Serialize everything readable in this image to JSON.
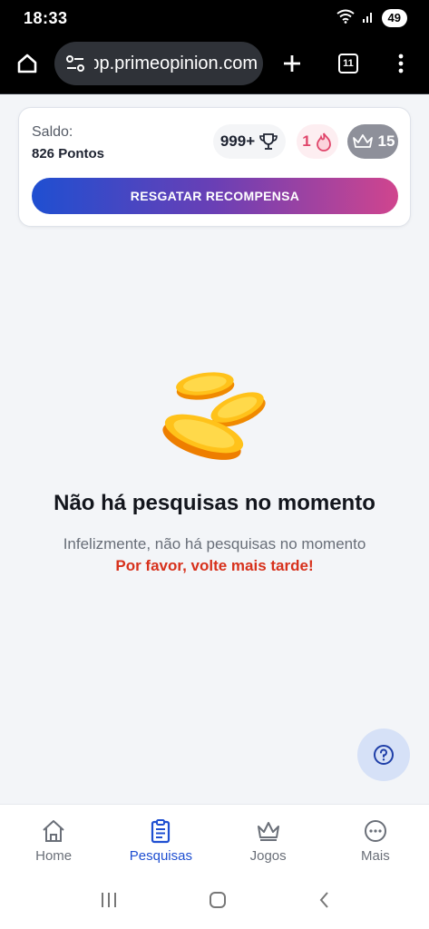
{
  "status_bar": {
    "time": "18:33",
    "battery": "49"
  },
  "browser": {
    "url": "app.primeopinion.com",
    "tab_count": "11"
  },
  "balance": {
    "label": "Saldo:",
    "value": "826 Pontos",
    "rank": "999+",
    "streak": "1",
    "level": "15",
    "redeem_label": "RESGATAR RECOMPENSA"
  },
  "empty_state": {
    "title": "Não há pesquisas no momento",
    "subtitle": "Infelizmente, não há pesquisas no momento",
    "cta": "Por favor, volte mais tarde!"
  },
  "nav": {
    "items": [
      {
        "label": "Home",
        "icon": "home-icon",
        "active": false
      },
      {
        "label": "Pesquisas",
        "icon": "clipboard-icon",
        "active": true
      },
      {
        "label": "Jogos",
        "icon": "crown-icon",
        "active": false
      },
      {
        "label": "Mais",
        "icon": "more-icon",
        "active": false
      }
    ]
  },
  "colors": {
    "accent": "#1f4fd1",
    "cta_red": "#d7311c",
    "gradient_start": "#1f4fd1",
    "gradient_end": "#d0458e"
  }
}
